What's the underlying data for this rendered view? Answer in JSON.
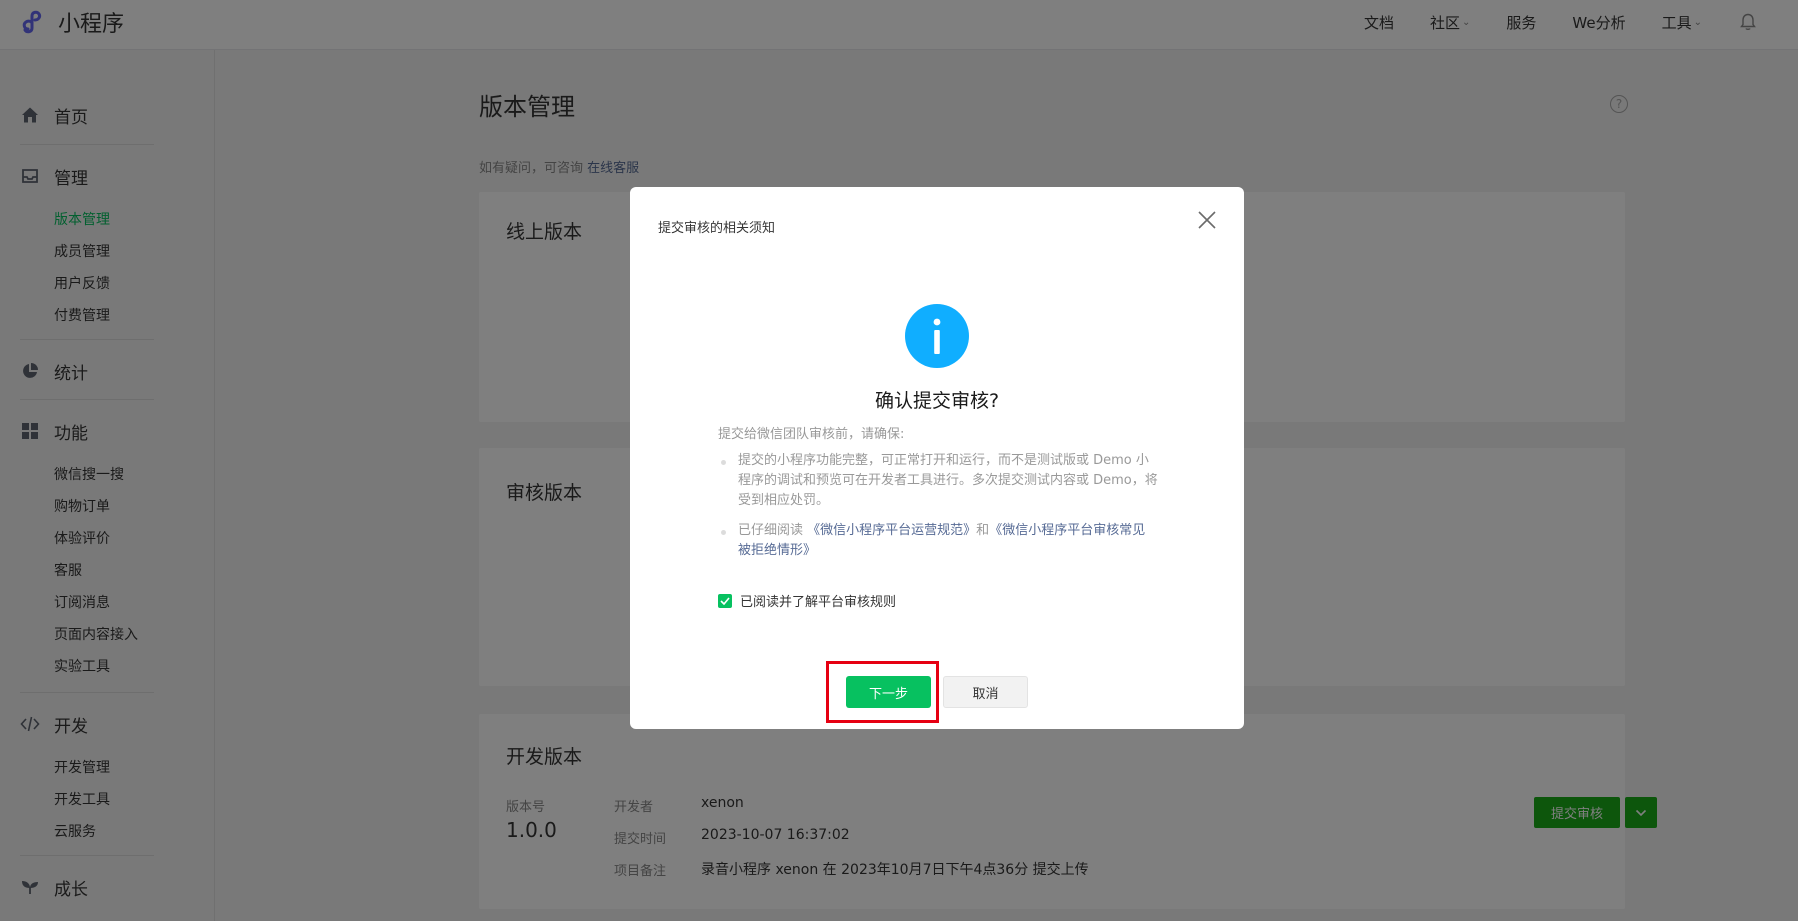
{
  "brand": {
    "name": "小程序"
  },
  "topnav": {
    "items": [
      {
        "label": "文档",
        "has_caret": false
      },
      {
        "label": "社区",
        "has_caret": true
      },
      {
        "label": "服务",
        "has_caret": false
      },
      {
        "label": "We分析",
        "has_caret": false
      },
      {
        "label": "工具",
        "has_caret": true
      }
    ],
    "bell_icon": "bell-icon"
  },
  "sidebar": {
    "home": {
      "label": "首页",
      "icon": "home-icon"
    },
    "manage": {
      "label": "管理",
      "icon": "inbox-icon",
      "items": [
        "版本管理",
        "成员管理",
        "用户反馈",
        "付费管理"
      ],
      "active_index": 0
    },
    "stats": {
      "label": "统计",
      "icon": "pie-chart-icon"
    },
    "features": {
      "label": "功能",
      "icon": "grid-icon",
      "items": [
        "微信搜一搜",
        "购物订单",
        "体验评价",
        "客服",
        "订阅消息",
        "页面内容接入",
        "实验工具"
      ]
    },
    "dev": {
      "label": "开发",
      "icon": "code-icon",
      "items": [
        "开发管理",
        "开发工具",
        "云服务"
      ]
    },
    "growth": {
      "label": "成长",
      "icon": "sprout-icon"
    }
  },
  "main": {
    "title": "版本管理",
    "hint_prefix": "如有疑问，可咨询",
    "hint_link": "在线客服",
    "online_card": {
      "title": "线上版本"
    },
    "review_card": {
      "title": "审核版本"
    },
    "dev_card": {
      "title": "开发版本",
      "version_label": "版本号",
      "version": "1.0.0",
      "developer_label": "开发者",
      "developer": "xenon",
      "submit_time_label": "提交时间",
      "submit_time": "2023-10-07 16:37:02",
      "note_label": "项目备注",
      "note": "录音小程序 xenon 在 2023年10月7日下午4点36分 提交上传",
      "submit_button": "提交审核"
    }
  },
  "dialog": {
    "title": "提交审核的相关须知",
    "heading": "确认提交审核?",
    "intro": "提交给微信团队审核前，请确保:",
    "item1": "提交的小程序功能完整，可正常打开和运行，而不是测试版或 Demo 小程序的调试和预览可在开发者工具进行。多次提交测试内容或 Demo，将受到相应处罚。",
    "item2_prefix": "已仔细阅读",
    "item2_link1": "《微信小程序平台运营规范》",
    "item2_mid": "和",
    "item2_link2": "《微信小程序平台审核常见被拒绝情形》",
    "agree_label": "已阅读并了解平台审核规则",
    "agree_checked": true,
    "next_button": "下一步",
    "cancel_button": "取消"
  },
  "colors": {
    "primary_green": "#07c160",
    "submit_green": "#1aad19",
    "info_blue": "#10aeff",
    "link": "#576b95",
    "highlight_red": "#e60012"
  }
}
